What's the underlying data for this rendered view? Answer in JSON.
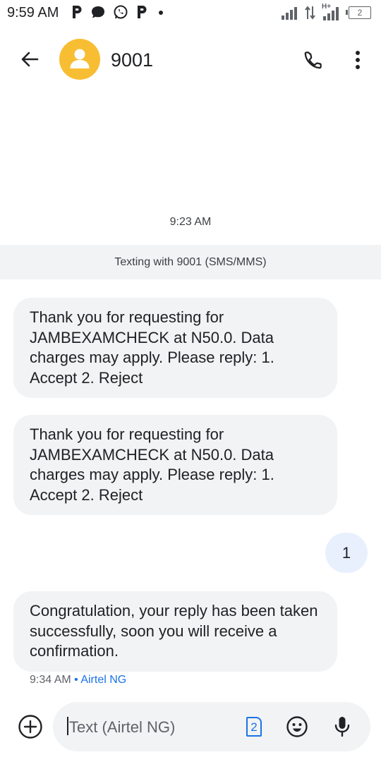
{
  "status_bar": {
    "time": "9:59 AM",
    "left_icons": [
      "p-app-icon",
      "message-icon",
      "whatsapp-icon",
      "p-app-icon",
      "dot-icon"
    ],
    "right_icons": [
      "signal-icon",
      "data-arrows-icon",
      "signal-hplus-icon",
      "battery-icon"
    ],
    "hplus_label": "H+",
    "battery_label": "2"
  },
  "header": {
    "contact_name": "9001",
    "avatar_color": "#f8be33"
  },
  "conversation": {
    "timestamp": "9:23 AM",
    "info_banner": "Texting with 9001 (SMS/MMS)",
    "messages": [
      {
        "direction": "incoming",
        "text": "Thank you for requesting for JAMBEXAMCHECK at N50.0. Data charges may apply. Please reply: 1. Accept 2. Reject"
      },
      {
        "direction": "incoming",
        "text": "Thank you for requesting for JAMBEXAMCHECK at N50.0. Data charges may apply. Please reply: 1. Accept 2. Reject"
      },
      {
        "direction": "outgoing",
        "text": "1"
      },
      {
        "direction": "incoming",
        "text": "Congratulation, your reply has been taken successfully, soon you will receive a confirmation."
      }
    ],
    "last_message_time": "9:34 AM",
    "last_message_separator": "•",
    "last_message_carrier": "Airtel NG"
  },
  "composer": {
    "placeholder": "Text (Airtel NG)",
    "sim_label": "2"
  },
  "colors": {
    "incoming_bubble": "#f1f3f4",
    "outgoing_bubble": "#e8f0fe",
    "accent": "#1a73e8"
  }
}
